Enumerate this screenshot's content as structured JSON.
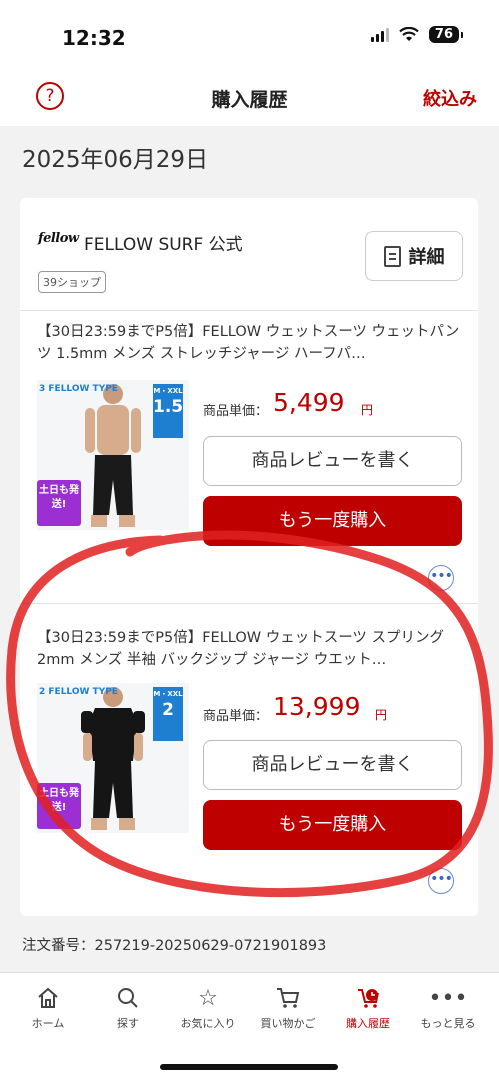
{
  "status_bar": {
    "time": "12:32",
    "battery": "76"
  },
  "header": {
    "title": "購入履歴",
    "filter_label": "絞込み",
    "help_symbol": "?"
  },
  "date": "2025年06月29日",
  "shop": {
    "logo": "fellow",
    "name": "FELLOW SURF 公式",
    "badge": "39ショップ",
    "detail_label": "詳細"
  },
  "items": [
    {
      "title": "【30日23:59までP5倍】FELLOW ウェットスーツ ウェットパンツ 1.5mm メンズ ストレッチジャージ ハーフパ…",
      "price_label": "商品単価：",
      "price": "5,499",
      "price_unit": "円",
      "thickness": "1.5",
      "size_range": "M・XXL",
      "type": "3 FELLOW TYPE",
      "promo": "土日も発送!",
      "review_label": "商品レビューを書く",
      "rebuy_label": "もう一度購入"
    },
    {
      "title": "【30日23:59までP5倍】FELLOW ウェットスーツ スプリング 2mm メンズ 半袖 バックジップ ジャージ ウエット…",
      "price_label": "商品単価：",
      "price": "13,999",
      "price_unit": "円",
      "thickness": "2",
      "size_range": "M・XXL",
      "type": "2 FELLOW TYPE",
      "promo": "土日も発送!",
      "review_label": "商品レビューを書く",
      "rebuy_label": "もう一度購入"
    }
  ],
  "order_number": "注文番号：257219-20250629-0721901893",
  "tabs": [
    {
      "label": "ホーム",
      "icon": "home-icon"
    },
    {
      "label": "探す",
      "icon": "search-icon"
    },
    {
      "label": "お気に入り",
      "icon": "star-icon"
    },
    {
      "label": "買い物かご",
      "icon": "cart-icon"
    },
    {
      "label": "購入履歴",
      "icon": "history-icon",
      "active": true
    },
    {
      "label": "もっと見る",
      "icon": "more-icon"
    }
  ],
  "colors": {
    "accent": "#bf0000",
    "annotation": "#e02020"
  }
}
